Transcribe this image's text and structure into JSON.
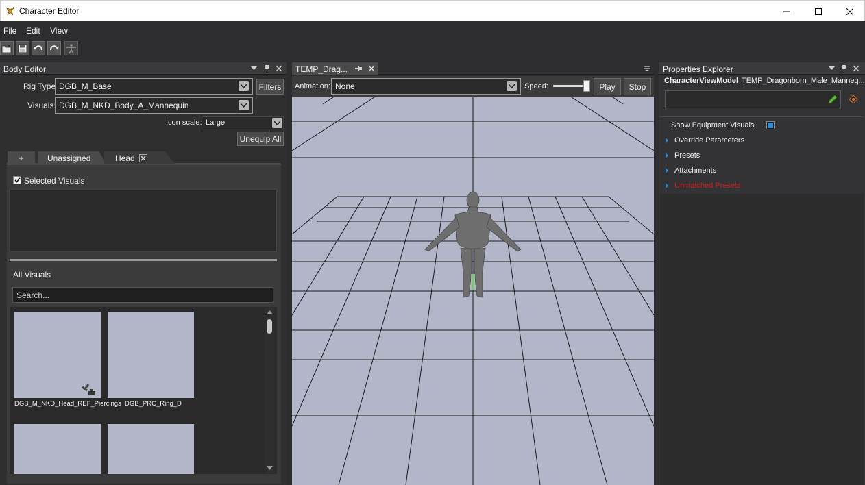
{
  "window": {
    "title": "Character Editor"
  },
  "menu": [
    "File",
    "Edit",
    "View"
  ],
  "toolbar": {
    "icons": [
      "open-icon",
      "save-icon",
      "undo-icon",
      "redo-icon",
      "character-pose-icon"
    ]
  },
  "body_editor": {
    "title": "Body Editor",
    "rig_type_label": "Rig Type:",
    "rig_type_value": "DGB_M_Base",
    "filters_label": "Filters",
    "visuals_label": "Visuals:",
    "visuals_value": "DGB_M_NKD_Body_A_Mannequin",
    "icon_scale_label": "Icon scale:",
    "icon_scale_value": "Large",
    "unequip_all_label": "Unequip All",
    "tabs": [
      "+",
      "Unassigned",
      "Head"
    ],
    "selected_visuals_label": "Selected Visuals",
    "selected_visuals_checked": true,
    "all_visuals_label": "All Visuals",
    "search_placeholder": "Search...",
    "items": [
      {
        "label": "DGB_M_NKD_Head_REF_Piercings"
      },
      {
        "label": "DGB_PRC_Ring_D"
      },
      {
        "label": ""
      },
      {
        "label": ""
      }
    ]
  },
  "viewport": {
    "tab_title": "TEMP_Drag...",
    "animation_label": "Animation:",
    "animation_value": "None",
    "speed_label": "Speed:",
    "speed_value": 1.0,
    "play_label": "Play",
    "stop_label": "Stop"
  },
  "properties": {
    "title": "Properties Explorer",
    "object_type": "CharacterViewModel",
    "object_name": "TEMP_Dragonborn_Male_Manneq...",
    "show_equipment_label": "Show Equipment Visuals",
    "show_equipment_checked": true,
    "rows": [
      "Override Parameters",
      "Presets",
      "Attachments",
      "Unmatched Presets"
    ]
  },
  "colors": {
    "accent": "#2f8fd8",
    "error": "#d02020",
    "viewport_bg": "#b3b6c9",
    "panel_bg": "#2f2f2f"
  }
}
